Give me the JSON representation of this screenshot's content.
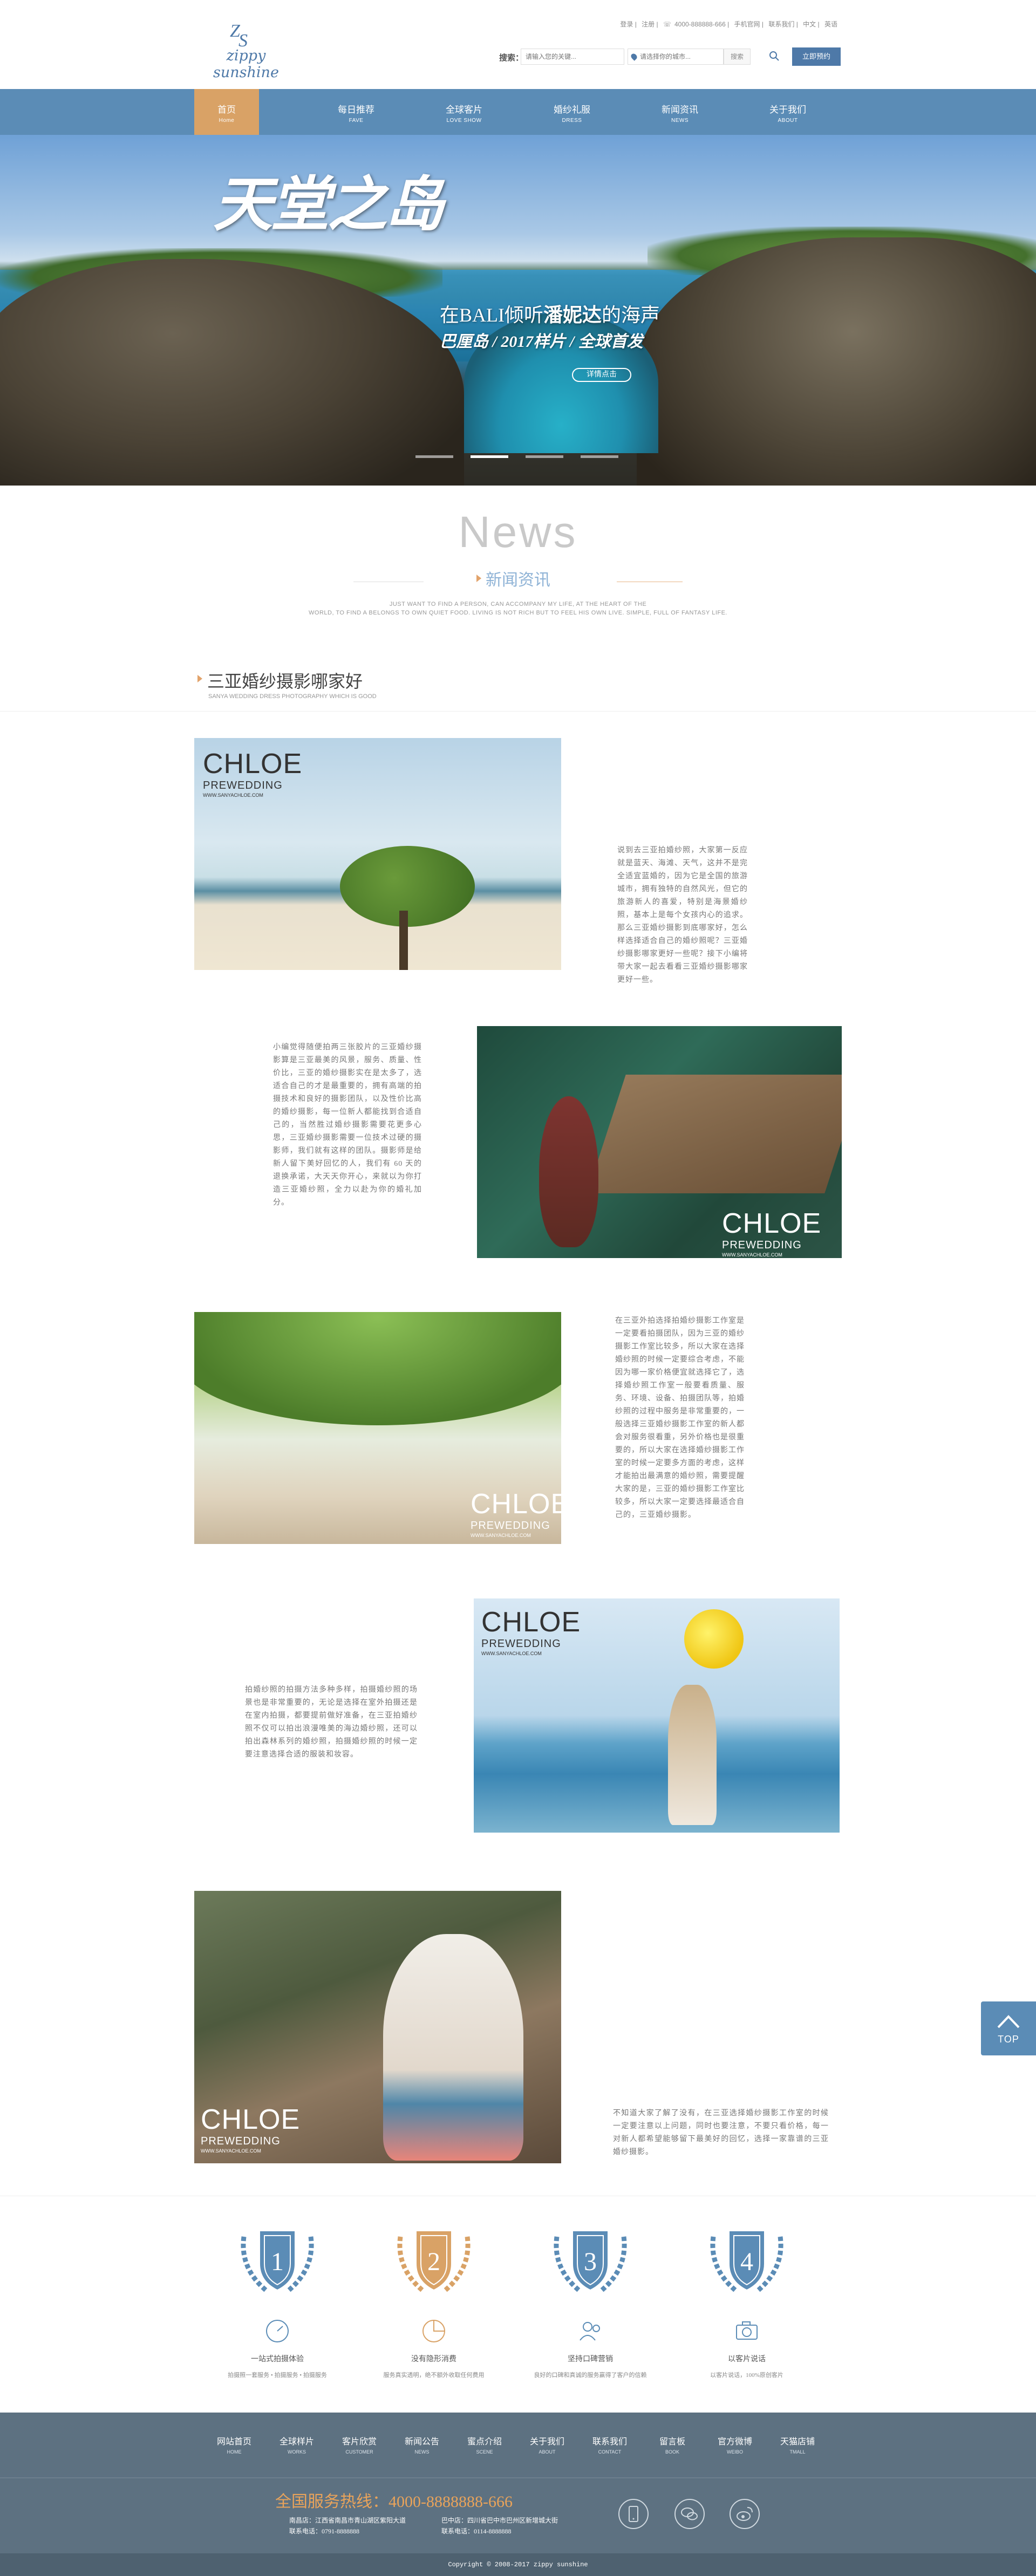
{
  "header": {
    "logo_text": "zippy sunshine",
    "top_links": [
      "登录",
      "注册",
      "4000-888888-666",
      "手机官网",
      "联系我们",
      "中文",
      "英语"
    ],
    "search_label": "搜索：",
    "search_placeholder": "请输入您的关键...",
    "location_placeholder": "请选择你的城市...",
    "query_button": "搜索",
    "book_button": "立即预约"
  },
  "nav": {
    "items": [
      {
        "cn": "首页",
        "en": "Home"
      },
      {
        "cn": "每日推荐",
        "en": "FAVE"
      },
      {
        "cn": "全球客片",
        "en": "LOVE SHOW"
      },
      {
        "cn": "婚纱礼服",
        "en": "DRESS"
      },
      {
        "cn": "新闻资讯",
        "en": "NEWS"
      },
      {
        "cn": "关于我们",
        "en": "ABOUT"
      }
    ]
  },
  "banner": {
    "title": "天堂之岛",
    "subtitle_prefix": "在BALI倾听",
    "subtitle_highlight": "潘妮达",
    "subtitle_suffix": "的海声",
    "subtitle2": "巴厘岛 / 2017样片 / 全球首发",
    "detail_button": "详情点击"
  },
  "news": {
    "title": "News",
    "subtitle": "新闻资讯",
    "desc_line1": "JUST WANT TO FIND A PERSON, CAN ACCOMPANY MY LIFE, AT THE HEART OF THE",
    "desc_line2": "WORLD, TO FIND A BELONGS TO OWN QUIET FOOD. LIVING IS NOT RICH BUT TO FEEL HIS OWN LIVE. SIMPLE, FULL OF FANTASY LIFE.",
    "section_title": "三亚婚纱摄影哪家好",
    "section_en": "SANYA WEDDING DRESS PHOTOGRAPHY WHICH IS GOOD"
  },
  "photo_caption": {
    "brand": "CHLOE",
    "line2": "PREWEDDING",
    "line3": "WWW.SANYACHLOE.COM"
  },
  "articles": [
    {
      "text": "说到去三亚拍婚纱照，大家第一反应就是蓝天、海滩、天气，这并不是完全适宜蓝婚的，因为它是全国的旅游城市，拥有独特的自然风光，但它的旅游新人的喜爱，特别是海景婚纱照，基本上是每个女孩内心的追求。那么三亚婚纱摄影到底哪家好，怎么样选择适合自己的婚纱照呢？三亚婚纱摄影哪家更好一些呢？接下小编将带大家一起去看看三亚婚纱摄影哪家更好一些。"
    },
    {
      "text": "小编觉得随便拍两三张胶片的三亚婚纱摄影算是三亚最美的风景，服务、质量、性价比，三亚的婚纱摄影实在是太多了，选适合自己的才是最重要的，拥有高端的拍摄技术和良好的摄影团队，以及性价比高的婚纱摄影，每一位新人都能找到合适自己的，当然胜过婚纱摄影需要花更多心思，三亚婚纱摄影需要一位技术过硬的摄影师，我们就有这样的团队。摄影师是给新人留下美好回忆的人，我们有 60 天的退换承诺，大天天你开心，来就以为你打造三亚婚纱照，全力以赴为你的婚礼加分。"
    },
    {
      "text": "在三亚外拍选择拍婚纱摄影工作室是一定要看拍摄团队，因为三亚的婚纱摄影工作室比较多，所以大家在选择婚纱照的时候一定要综合考虑，不能因为哪一家价格便宜就选择它了，选择婚纱照工作室一般要看质量、服务、环境、设备、拍摄团队等，拍婚纱照的过程中服务是非常重要的，一般选择三亚婚纱摄影工作室的新人都会对服务很看重，另外价格也是很重要的，所以大家在选择婚纱摄影工作室的时候一定要多方面的考虑，这样才能拍出最满意的婚纱照，需要提醒大家的是，三亚的婚纱摄影工作室比较多，所以大家一定要选择最适合自己的，三亚婚纱摄影。"
    },
    {
      "text": "拍婚纱照的拍摄方法多种多样，拍摄婚纱照的场景也是非常重要的，无论是选择在室外拍摄还是在室内拍摄，都要提前做好准备，在三亚拍婚纱照不仅可以拍出浪漫唯美的海边婚纱照，还可以拍出森林系列的婚纱照，拍摄婚纱照的时候一定要注意选择合适的服装和妆容。"
    },
    {
      "text": "不知道大家了解了没有，在三亚选择婚纱摄影工作室的时候一定要注意以上问题，同时也要注意，不要只看价格，每一对新人都希望能够留下最美好的回忆，选择一家靠谱的三亚婚纱摄影。"
    }
  ],
  "back_to_top": "TOP",
  "features": [
    {
      "num": "1",
      "title": "一站式拍摄体验",
      "desc": "拍摄照一套服务 • 拍摄服务 • 拍摄服务"
    },
    {
      "num": "2",
      "title": "没有隐形消费",
      "desc": "服务真实透明，绝不额外收取任何费用"
    },
    {
      "num": "3",
      "title": "坚持口碑营销",
      "desc": "良好的口碑和真诚的服务赢得了客户的信赖"
    },
    {
      "num": "4",
      "title": "以客片说话",
      "desc": "以客片说话，100%原创客片"
    }
  ],
  "footer": {
    "nav": [
      {
        "cn": "网站首页",
        "en": "HOME"
      },
      {
        "cn": "全球样片",
        "en": "WORKS"
      },
      {
        "cn": "客片欣赏",
        "en": "CUSTOMER"
      },
      {
        "cn": "新闻公告",
        "en": "NEWS"
      },
      {
        "cn": "蜜点介绍",
        "en": "SCENE"
      },
      {
        "cn": "关于我们",
        "en": "ABOUT"
      },
      {
        "cn": "联系我们",
        "en": "CONTACT"
      },
      {
        "cn": "留言板",
        "en": "BOOK"
      },
      {
        "cn": "官方微博",
        "en": "WEIBO"
      },
      {
        "cn": "天猫店铺",
        "en": "TMALL"
      }
    ],
    "hotline": "全国服务热线：4000-8888888-666",
    "addr1_line1": "南昌店：江西省南昌市青山湖区紫阳大道",
    "addr1_line2": "联系电话：0791-8888888",
    "addr2_line1": "巴中店：四川省巴中市巴州区新增城大街",
    "addr2_line2": "联系电话：0114-8888888",
    "copyright": "Copyright © 2008-2017 zippy sunshine"
  },
  "colors": {
    "primary_blue": "#5b8cb6",
    "accent_orange": "#d9a266",
    "footer_bg": "#5d7181"
  }
}
